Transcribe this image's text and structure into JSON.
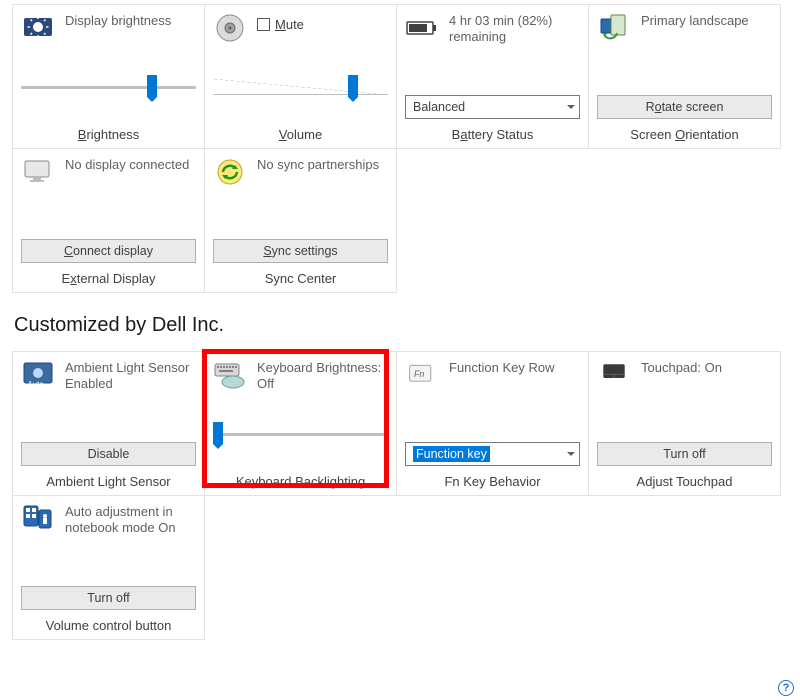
{
  "tiles_top": {
    "display_brightness": {
      "title": "Display brightness",
      "footer_pre": "B",
      "footer_post": "rightness",
      "slider_pct": 75
    },
    "volume": {
      "mute_accel": "M",
      "mute_post": "ute",
      "footer_pre": "V",
      "footer_post": "olume",
      "slider_pct": 80
    },
    "battery": {
      "title": "4 hr 03 min (82%) remaining",
      "select_value": "Balanced",
      "footer_pre1": "B",
      "footer_mid": "a",
      "footer_post1": "ttery Status"
    },
    "orientation": {
      "title": "Primary landscape",
      "button_pre": "R",
      "button_accel": "o",
      "button_post": "tate screen",
      "footer_pre": "Screen ",
      "footer_accel": "O",
      "footer_post": "rientation"
    },
    "external_display": {
      "title": "No display connected",
      "button_accel": "C",
      "button_post": "onnect display",
      "footer_pre": "E",
      "footer_accel": "x",
      "footer_post": "ternal Display"
    },
    "sync": {
      "title": "No sync partnerships",
      "button_accel": "S",
      "button_post": "ync settings",
      "footer": "Sync Center"
    }
  },
  "section_title": "Customized by Dell Inc.",
  "tiles_dell": {
    "ambient": {
      "title": "Ambient Light Sensor Enabled",
      "button": "Disable",
      "footer": "Ambient Light Sensor"
    },
    "keyboard": {
      "title": "Keyboard Brightness: Off",
      "slider_pct": 3,
      "footer": "Keyboard Backlighting"
    },
    "fnkey": {
      "title": "Function Key Row",
      "select_value": "Function key",
      "footer": "Fn Key Behavior"
    },
    "touchpad": {
      "title": "Touchpad: On",
      "button": "Turn off",
      "footer": "Adjust Touchpad"
    },
    "volume_ctrl": {
      "title": "Auto adjustment in notebook mode On",
      "button": "Turn off",
      "footer": "Volume control button"
    }
  },
  "help_glyph": "?"
}
